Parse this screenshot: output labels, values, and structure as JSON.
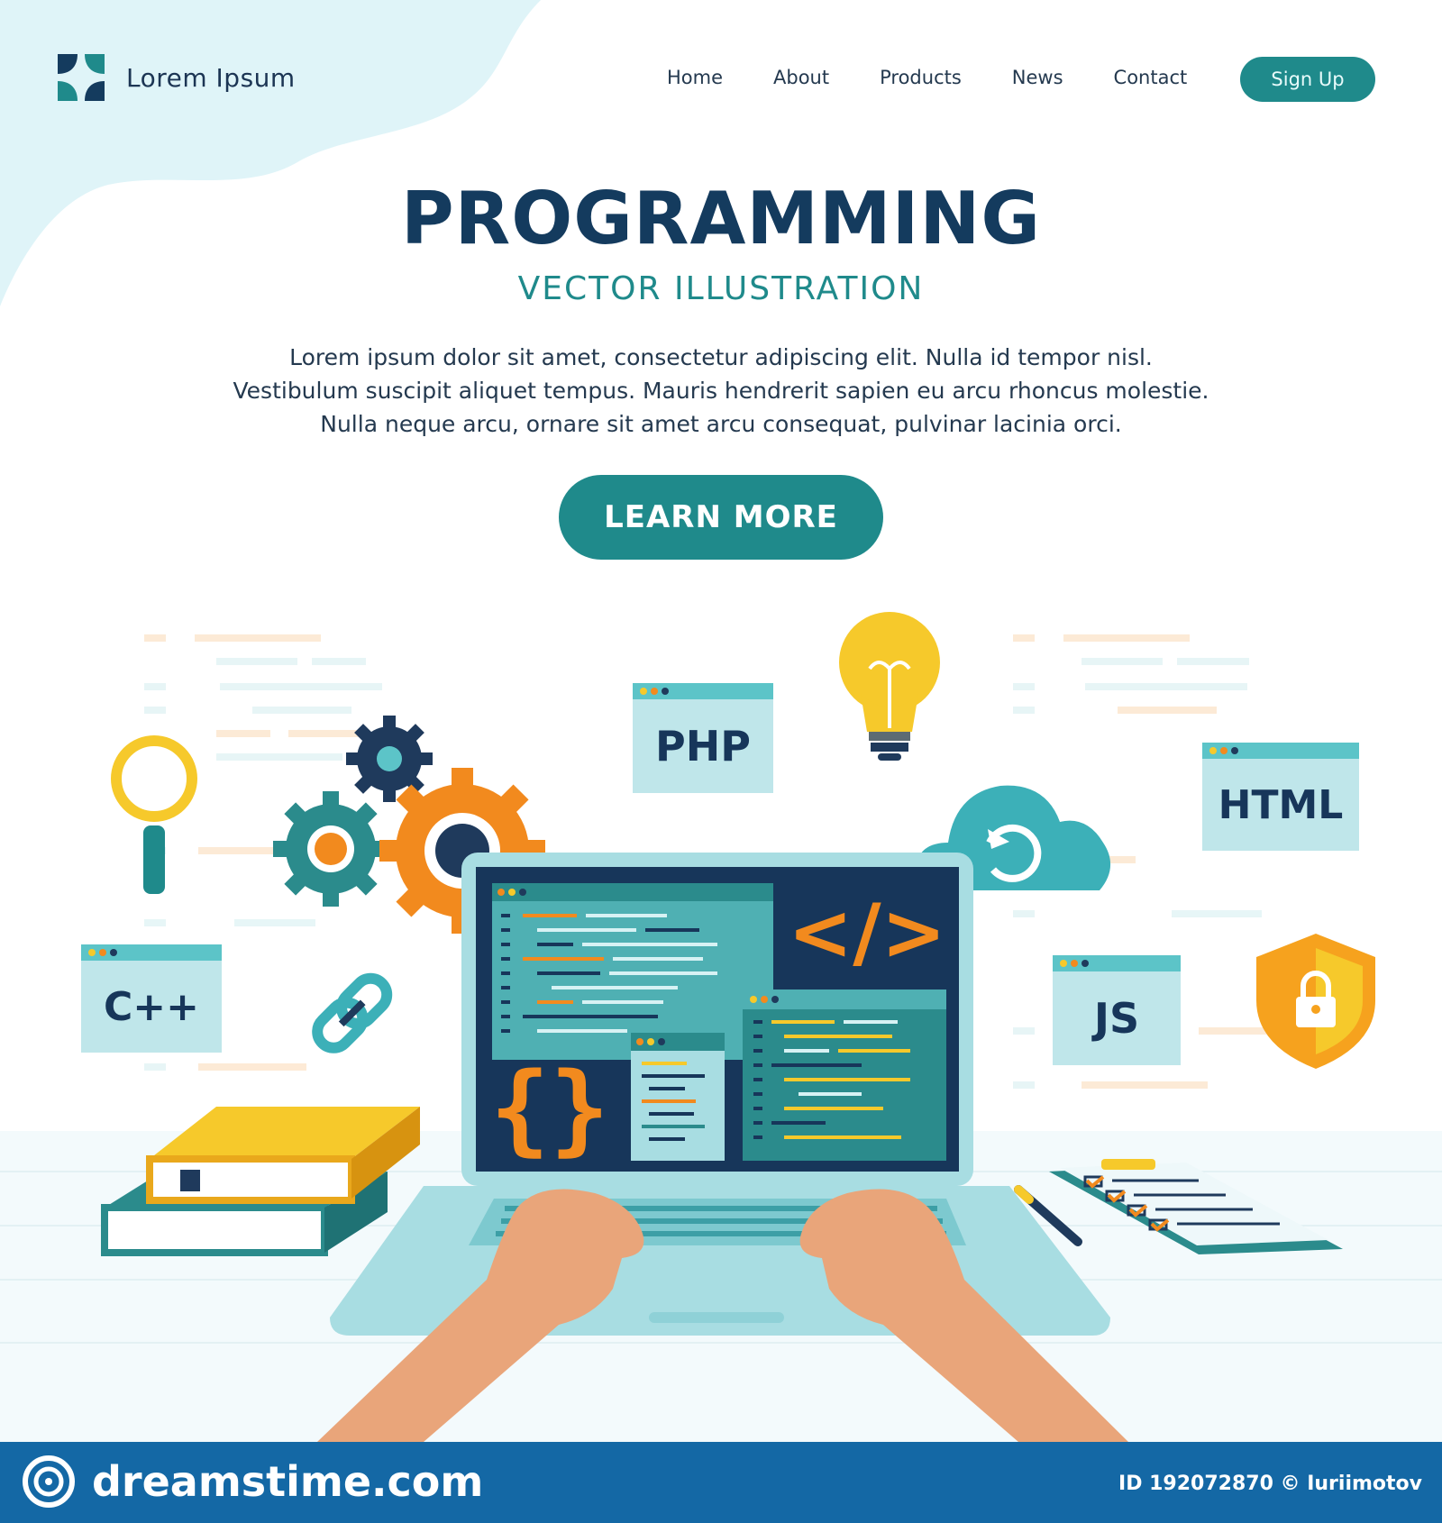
{
  "header": {
    "logo_text": "Lorem Ipsum",
    "nav": [
      "Home",
      "About",
      "Products",
      "News",
      "Contact"
    ],
    "signup_label": "Sign Up"
  },
  "hero": {
    "title": "PROGRAMMING",
    "subtitle": "VECTOR  ILLUSTRATION",
    "body": [
      "Lorem ipsum dolor sit amet, consectetur adipiscing elit. Nulla id tempor nisl.",
      "Vestibulum suscipit aliquet tempus. Mauris hendrerit sapien eu arcu rhoncus molestie.",
      "Nulla neque arcu, ornare sit amet arcu consequat, pulvinar lacinia orci."
    ],
    "cta_label": "LEARN MORE"
  },
  "illustration": {
    "tags": {
      "php": "PHP",
      "html": "HTML",
      "cpp": "C++",
      "js": "JS"
    },
    "code_symbol": "</>",
    "braces_symbol": "{}"
  },
  "footer": {
    "brand": "dreamstime.com",
    "credit": "ID 192072870 © Iuriimotov"
  },
  "colors": {
    "primary_teal": "#1f8a8b",
    "navy": "#143b5e",
    "orange": "#f28a1e",
    "yellow": "#f6c92b",
    "footer_blue": "#1468a5"
  }
}
